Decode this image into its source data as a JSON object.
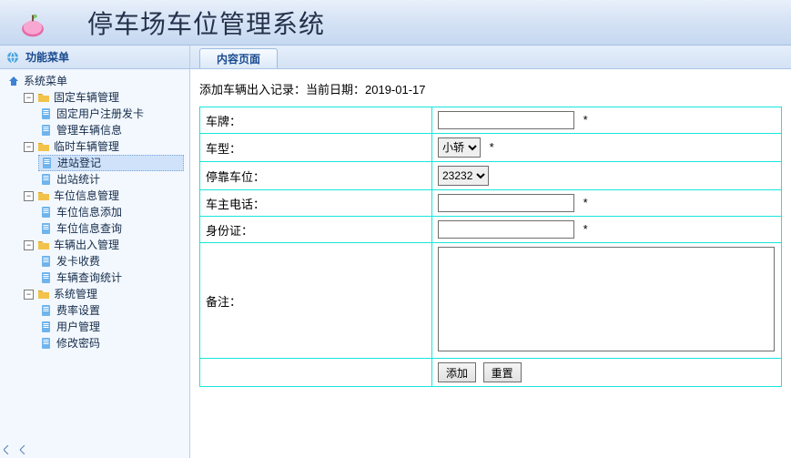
{
  "header": {
    "title": "停车场车位管理系统"
  },
  "sidebar": {
    "title": "功能菜单",
    "root": {
      "label": "系统菜单"
    },
    "groups": [
      {
        "label": "固定车辆管理",
        "items": [
          {
            "label": "固定用户注册发卡"
          },
          {
            "label": "管理车辆信息"
          }
        ]
      },
      {
        "label": "临时车辆管理",
        "items": [
          {
            "label": "进站登记",
            "selected": true
          },
          {
            "label": "出站统计"
          }
        ]
      },
      {
        "label": "车位信息管理",
        "items": [
          {
            "label": "车位信息添加"
          },
          {
            "label": "车位信息查询"
          }
        ]
      },
      {
        "label": "车辆出入管理",
        "items": [
          {
            "label": "发卡收费"
          },
          {
            "label": "车辆查询统计"
          }
        ]
      },
      {
        "label": "系统管理",
        "items": [
          {
            "label": "费率设置"
          },
          {
            "label": "用户管理"
          },
          {
            "label": "修改密码"
          }
        ]
      }
    ]
  },
  "tabs": [
    {
      "label": "内容页面"
    }
  ],
  "form": {
    "title": "添加车辆出入记录：当前日期：2019-01-17",
    "fields": {
      "plate": {
        "label": "车牌：",
        "value": "",
        "required": true
      },
      "type": {
        "label": "车型：",
        "options": [
          "小轿"
        ],
        "selected": "小轿",
        "required": true
      },
      "slot": {
        "label": "停靠车位：",
        "options": [
          "23232"
        ],
        "selected": "23232"
      },
      "phone": {
        "label": "车主电话：",
        "value": "",
        "required": true
      },
      "idcard": {
        "label": "身份证：",
        "value": "",
        "required": true
      },
      "remark": {
        "label": "备注：",
        "value": ""
      }
    },
    "buttons": {
      "submit": "添加",
      "reset": "重置"
    },
    "required_mark": "*"
  }
}
